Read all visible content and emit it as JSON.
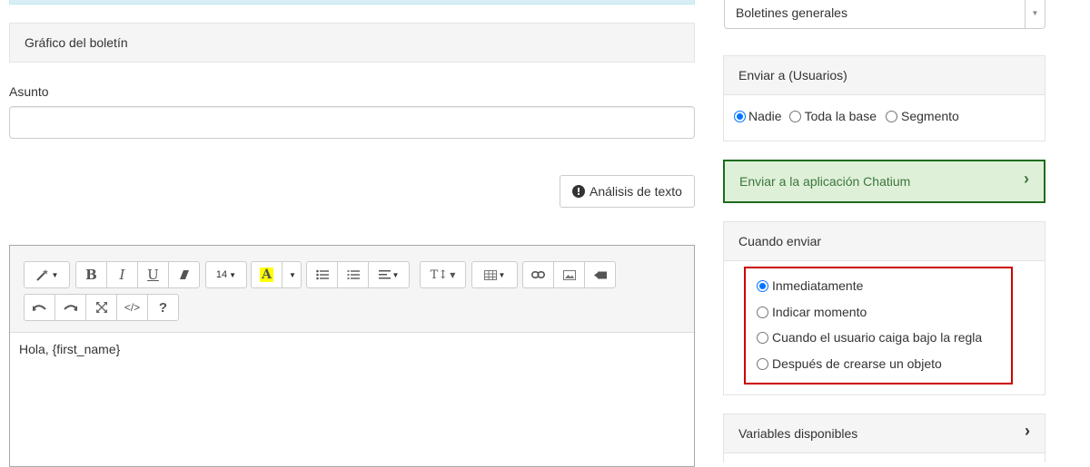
{
  "left": {
    "graphic_heading": "Gráfico del boletín",
    "subject_label": "Asunto",
    "subject_value": "",
    "text_analysis_button": "Análisis de texto"
  },
  "editor": {
    "font_size": "14",
    "highlight_letter": "A",
    "text_style_label": "T↕",
    "code_label": "</>",
    "help_label": "?",
    "content": "Hola, {first_name}"
  },
  "right": {
    "bulletin_select": "Boletines generales",
    "send_to": {
      "heading": "Enviar a (Usuarios)",
      "options": [
        {
          "label": "Nadie",
          "checked": true
        },
        {
          "label": "Toda la base",
          "checked": false
        },
        {
          "label": "Segmento",
          "checked": false
        }
      ]
    },
    "chatium_label": "Enviar a la aplicación Chatium",
    "when_send": {
      "heading": "Cuando enviar",
      "options": [
        {
          "label": "Inmediatamente",
          "checked": true
        },
        {
          "label": "Indicar momento",
          "checked": false
        },
        {
          "label": "Cuando el usuario caiga bajo la regla",
          "checked": false
        },
        {
          "label": "Después de crearse un objeto",
          "checked": false
        }
      ]
    },
    "variables_label": "Variables disponibles"
  },
  "colors": {
    "radio_accent": "#0075ff",
    "chatium_bg": "#dff0d8",
    "chatium_border": "#1e6b1e",
    "highlight_box": "#cc0000",
    "info_strip": "#d9edf7"
  },
  "icons": [
    "magic-wand-icon",
    "bold-icon",
    "italic-icon",
    "underline-icon",
    "eraser-icon",
    "highlight-icon",
    "unordered-list-icon",
    "ordered-list-icon",
    "align-icon",
    "text-height-icon",
    "table-icon",
    "link-icon",
    "picture-icon",
    "video-icon",
    "undo-icon",
    "redo-icon",
    "fullscreen-icon",
    "code-view-icon",
    "help-icon",
    "exclamation-icon",
    "chevron-right-icon",
    "select-arrow-icon"
  ]
}
